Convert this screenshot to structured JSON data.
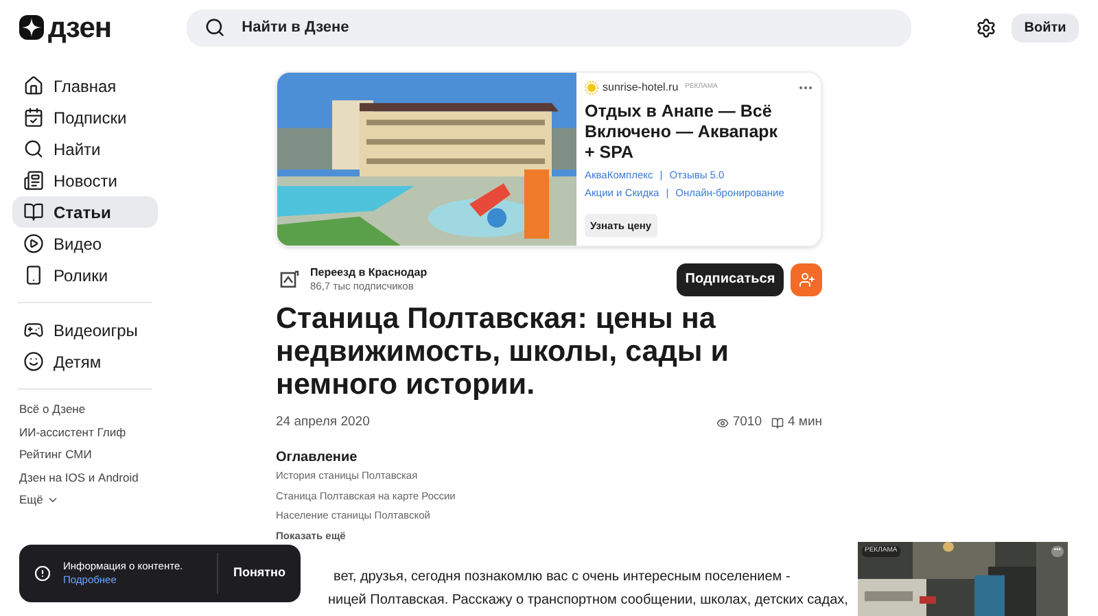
{
  "header": {
    "logo": "дзен",
    "search": {
      "placeholder": "Найти в Дзене"
    },
    "login": "Войти"
  },
  "sidebar": {
    "items": [
      {
        "label": "Главная",
        "selected": false
      },
      {
        "label": "Подписки",
        "selected": false
      },
      {
        "label": "Найти",
        "selected": false
      },
      {
        "label": "Новости",
        "selected": false
      },
      {
        "label": "Статьи",
        "selected": true
      },
      {
        "label": "Видео",
        "selected": false
      },
      {
        "label": "Ролики",
        "selected": false
      }
    ],
    "extra_items": [
      {
        "label": "Видеоигры",
        "selected": false
      },
      {
        "label": "Детям",
        "selected": false
      }
    ],
    "links": [
      "Всё о Дзене",
      "ИИ-ассистент Глиф",
      "Рейтинг СМИ",
      "Дзен на IOS и Android"
    ],
    "more": "Ещё"
  },
  "ad": {
    "kind": "picture",
    "domain": "sunrise-hotel.ru",
    "label": "РЕКЛАМА",
    "title": "Отдых в Анапе — Всё Включено — Аквапарк + SPA",
    "links": [
      [
        "АкваКомплекс",
        "Отзывы 5.0"
      ],
      [
        "Акции и Скидка",
        "Онлайн-бронирование"
      ]
    ],
    "separator": "|",
    "button": "Узнать цену"
  },
  "channel": {
    "name": "Переезд в Краснодар",
    "subscribers": "86,7 тыс подписчиков",
    "subscribe": "Подписаться"
  },
  "article": {
    "title": "Станица Полтавская: цены на недвижимость, школы, сады и немного истории.",
    "date": "24 апреля 2020",
    "views": "7010",
    "read_time": "4 мин",
    "toc": {
      "heading": "Оглавление",
      "items": [
        "История станицы Полтавская",
        "Станица Полтавская на карте России",
        "Население станицы Полтавской"
      ],
      "more": "Показать ещё"
    },
    "body_lines": [
      "вет, друзья, сегодня познакомлю вас с очень интересным поселением -",
      "ницей Полтавская. Расскажу о транспортном сообщении, школах, детских садах,"
    ]
  },
  "side_ad": {
    "kind": "picture",
    "label": "РЕКЛАМА",
    "menu": "•••"
  },
  "toast": {
    "text": "Информация о контенте.",
    "link": "Подробнее",
    "button": "Понятно"
  }
}
